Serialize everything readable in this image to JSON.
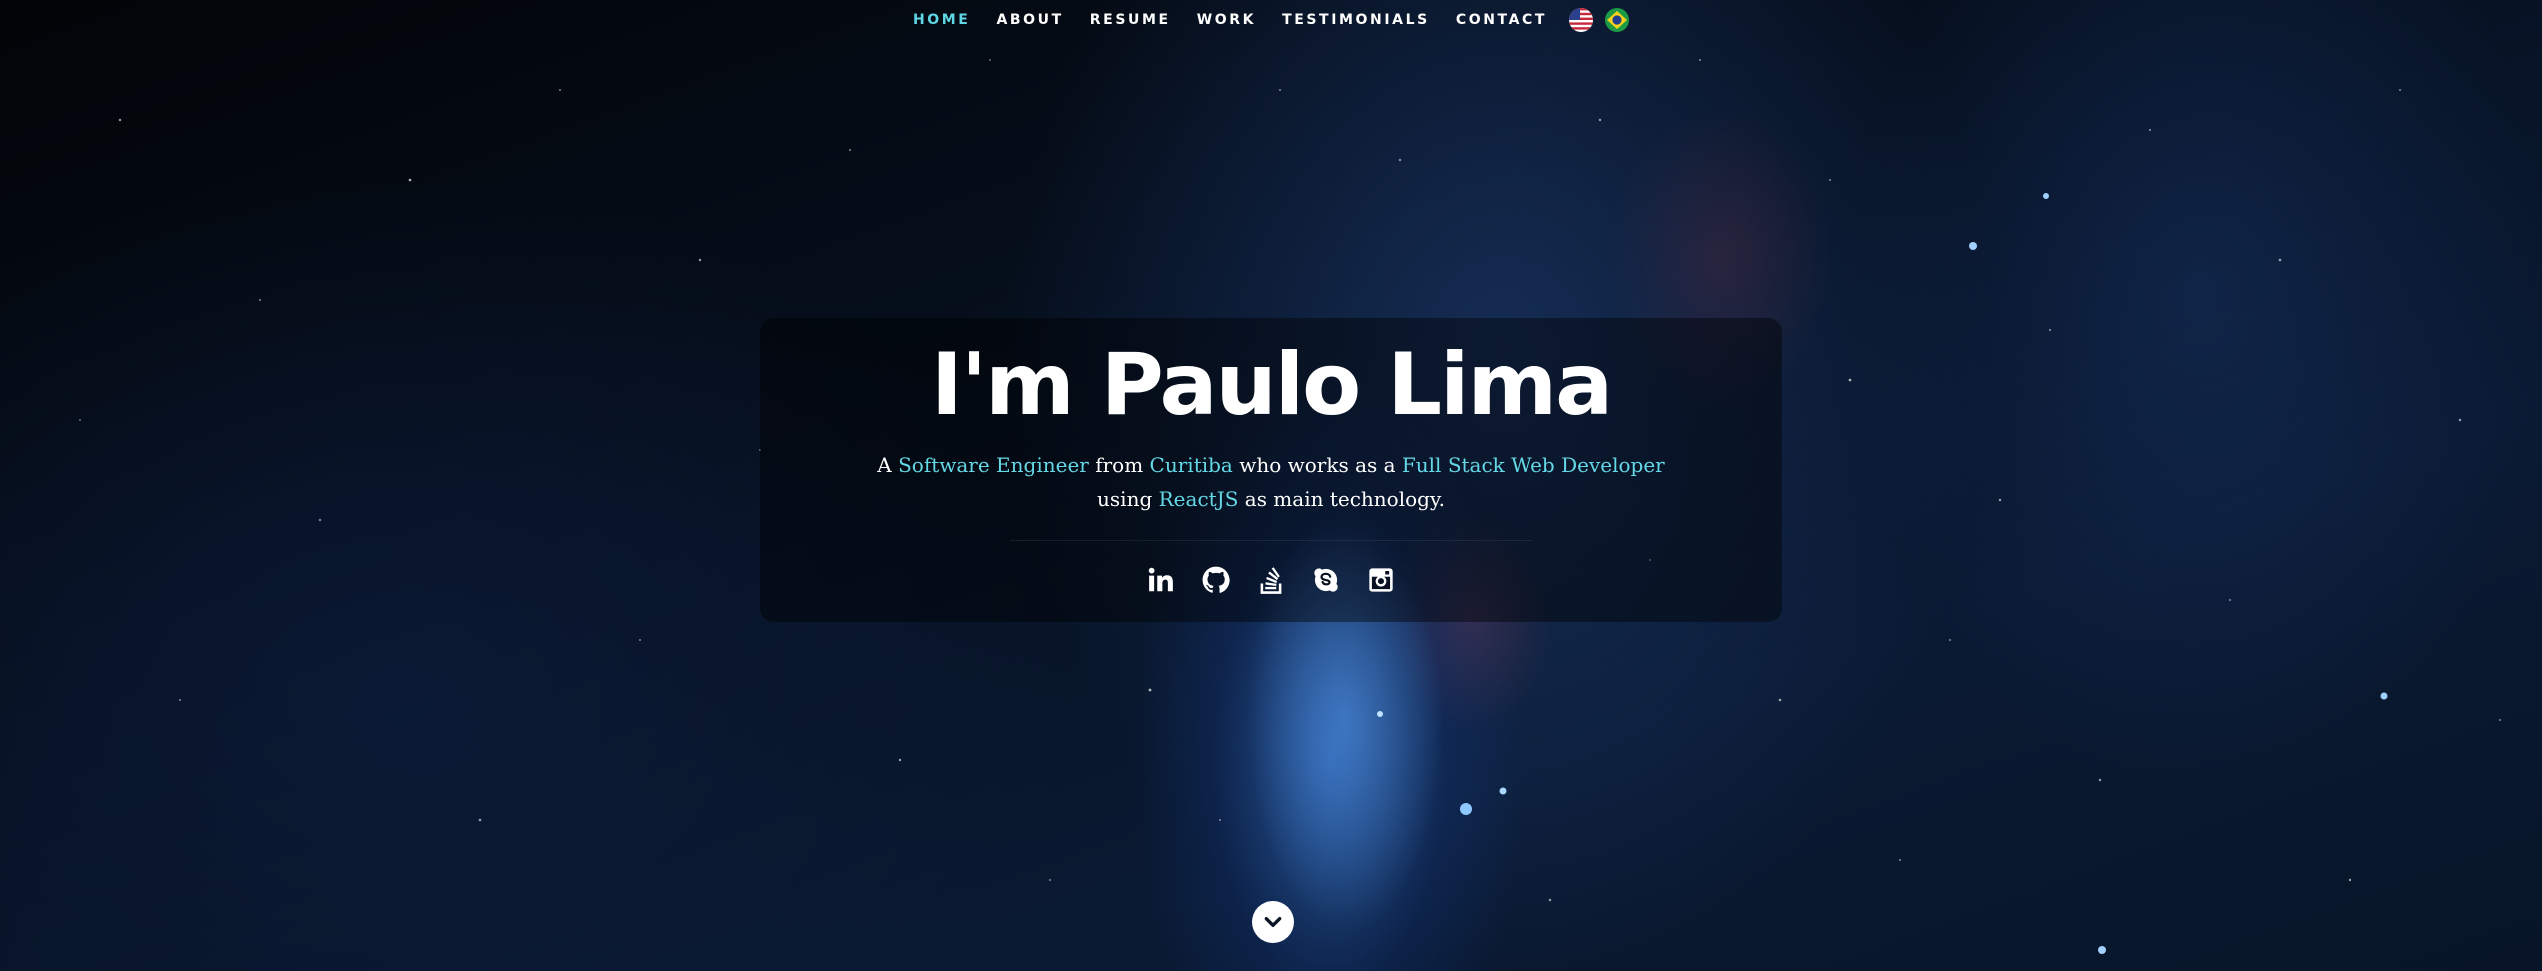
{
  "nav": {
    "items": [
      {
        "label": "HOME",
        "active": true
      },
      {
        "label": "ABOUT",
        "active": false
      },
      {
        "label": "RESUME",
        "active": false
      },
      {
        "label": "WORK",
        "active": false
      },
      {
        "label": "TESTIMONIALS",
        "active": false
      },
      {
        "label": "CONTACT",
        "active": false
      }
    ],
    "flags": [
      "us-flag-icon",
      "brazil-flag-icon"
    ]
  },
  "hero": {
    "title": "I'm Paulo Lima",
    "description": {
      "p1": "A ",
      "h1": "Software Engineer",
      "p2": " from ",
      "h2": "Curitiba",
      "p3": " who works as a ",
      "h3": "Full Stack Web Developer",
      "p4": " using ",
      "h4": "ReactJS",
      "p5": " as main technology."
    },
    "social_icons": [
      "linkedin-icon",
      "github-icon",
      "stackoverflow-icon",
      "skype-icon",
      "instagram-icon"
    ]
  },
  "scroll_down_icon": "chevron-down-icon",
  "colors": {
    "accent": "#5fd6e3",
    "text": "#ffffff"
  }
}
